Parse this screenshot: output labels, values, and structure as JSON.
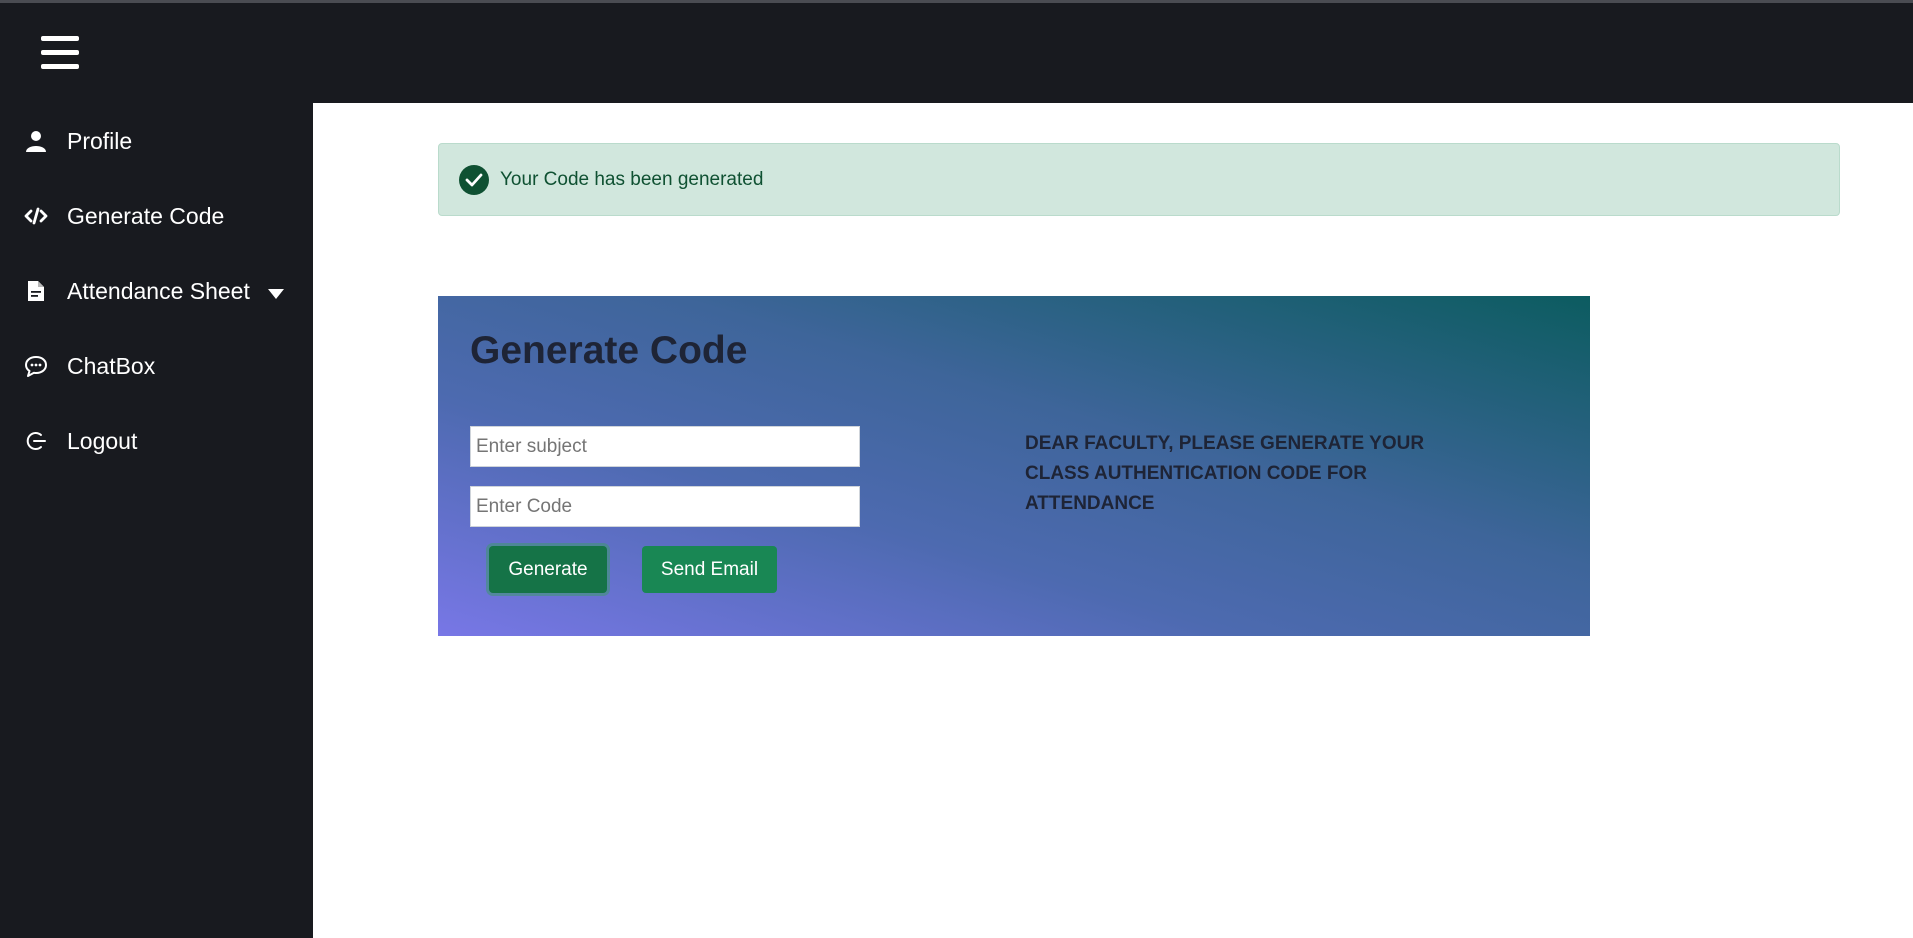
{
  "sidebar": {
    "items": [
      {
        "label": "Profile",
        "icon": "user-icon"
      },
      {
        "label": "Generate Code",
        "icon": "code-icon"
      },
      {
        "label": "Attendance Sheet",
        "icon": "document-icon",
        "has_dropdown": true
      },
      {
        "label": "ChatBox",
        "icon": "chat-icon"
      },
      {
        "label": "Logout",
        "icon": "logout-icon"
      }
    ]
  },
  "alert": {
    "message": "Your Code has been generated",
    "icon": "check-circle-icon"
  },
  "card": {
    "title": "Generate Code",
    "subject_placeholder": "Enter subject",
    "code_placeholder": "Enter Code",
    "generate_label": "Generate",
    "send_email_label": "Send Email",
    "note": "DEAR FACULTY, PLEASE GENERATE YOUR CLASS AUTHENTICATION CODE FOR ATTENDANCE"
  },
  "colors": {
    "sidebar_bg": "#181a1f",
    "alert_bg": "#d1e7dd",
    "alert_text": "#0f5132",
    "button_green": "#198754"
  }
}
